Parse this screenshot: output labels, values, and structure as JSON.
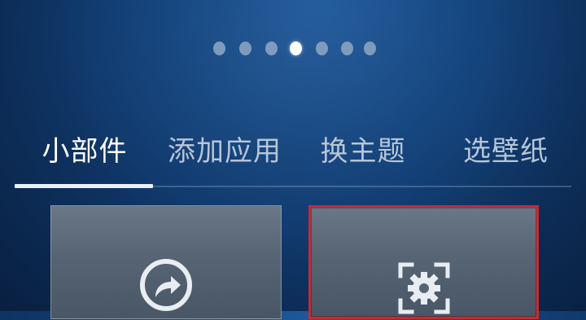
{
  "pager": {
    "count": 7,
    "active_index": 3
  },
  "tabs": [
    {
      "label": "小部件",
      "active": true
    },
    {
      "label": "添加应用",
      "active": false
    },
    {
      "label": "换主题",
      "active": false
    },
    {
      "label": "选壁纸",
      "active": false
    }
  ],
  "cards": [
    {
      "icon": "share-arrow-icon",
      "selected": false
    },
    {
      "icon": "gear-frame-icon",
      "selected": true
    }
  ],
  "colors": {
    "background": "#15457e",
    "active_tab": "#ffffff",
    "inactive_tab": "#b7c6d9",
    "selection_border": "#c62a33",
    "card": "#566474"
  }
}
